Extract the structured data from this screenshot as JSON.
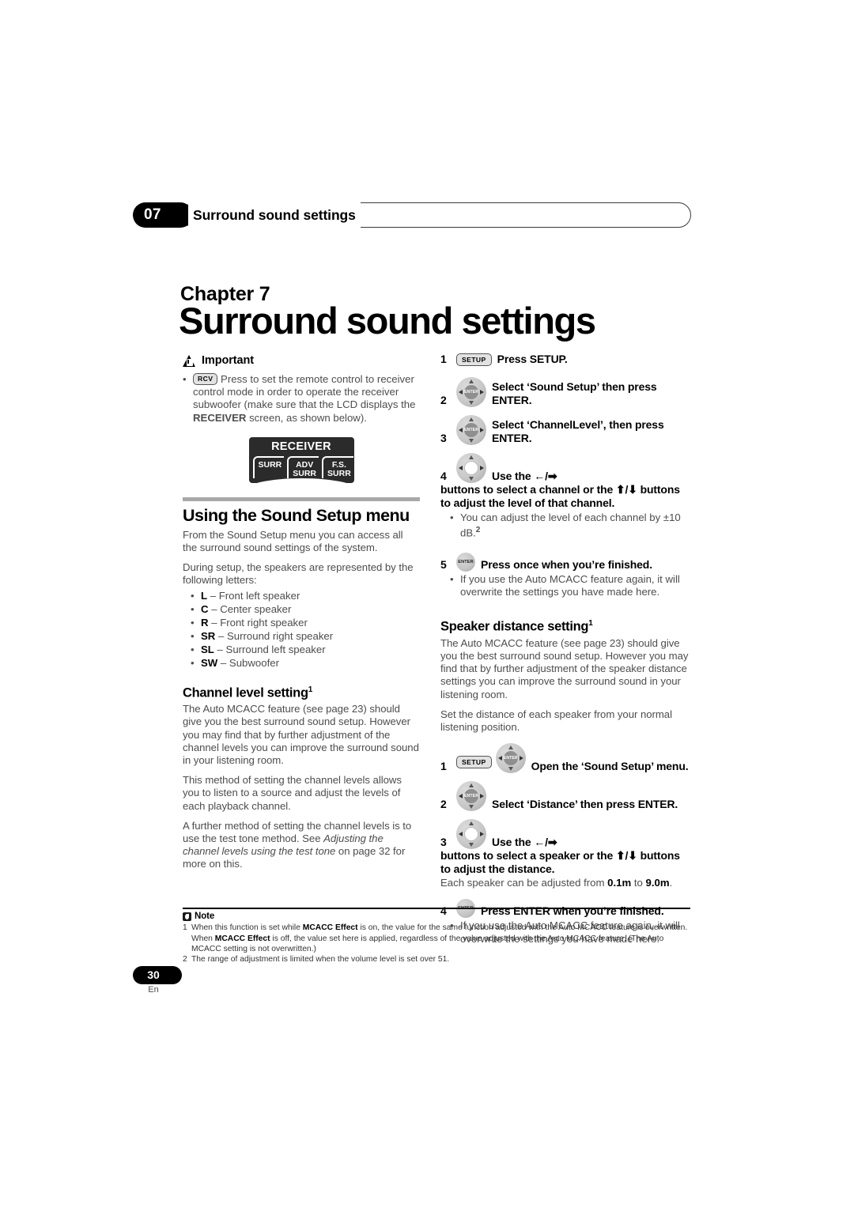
{
  "header": {
    "chapter_number": "07",
    "running_title": "Surround sound settings"
  },
  "chapter": {
    "label": "Chapter 7",
    "title": "Surround sound settings"
  },
  "left_column": {
    "important": {
      "heading": "Important",
      "icon": "warning-triangle-icon",
      "bullet_key": "RCV",
      "bullet_text_1": "Press to set the remote control to receiver control mode in order to operate the receiver subwoofer (make sure that the LCD displays the ",
      "bullet_bold": "RECEIVER",
      "bullet_text_2": " screen, as shown below)."
    },
    "lcd": {
      "title": "RECEIVER",
      "tabs": [
        "SURR",
        "ADV\nSURR",
        "F.S.\nSURR"
      ],
      "tab1": "SURR",
      "tab2_line1": "ADV",
      "tab2_line2": "SURR",
      "tab3_line1": "F.S.",
      "tab3_line2": "SURR"
    },
    "sound_setup": {
      "heading": "Using the Sound Setup menu",
      "para1": "From the Sound Setup menu you can access all the surround sound settings of the system.",
      "para2": "During setup, the speakers are represented by the following letters:",
      "speakers": [
        {
          "code": "L",
          "desc": " – Front left speaker"
        },
        {
          "code": "C",
          "desc": " – Center speaker"
        },
        {
          "code": "R",
          "desc": " – Front right speaker"
        },
        {
          "code": "SR",
          "desc": " – Surround right speaker"
        },
        {
          "code": "SL",
          "desc": " – Surround left speaker"
        },
        {
          "code": "SW",
          "desc": " – Subwoofer"
        }
      ]
    },
    "channel_level": {
      "heading": "Channel level setting",
      "heading_sup": "1",
      "para1": "The Auto MCACC feature (see page 23) should give you the best surround sound setup. However you may find that by further adjustment of the channel levels you can improve the surround sound in your listening room.",
      "para2": "This method of setting the channel levels allows you to listen to a source and adjust the levels of each playback channel.",
      "para3_a": "A further method of setting the channel levels is to use the test tone method. See ",
      "para3_italic": "Adjusting the channel levels using the test tone",
      "para3_b": " on page 32 for more on this."
    }
  },
  "right_column": {
    "channel_steps": [
      {
        "num": "1",
        "icons": [
          "setup-key"
        ],
        "text": "Press SETUP."
      },
      {
        "num": "2",
        "icons": [
          "nav-pad-enter"
        ],
        "text": "Select ‘Sound Setup’ then press ENTER."
      },
      {
        "num": "3",
        "icons": [
          "nav-pad-enter"
        ],
        "text": "Select ‘ChannelLevel’, then press ENTER."
      },
      {
        "num": "4",
        "icons": [
          "nav-pad-hollow"
        ],
        "text_a": "Use the ",
        "text_b": " buttons to select a channel or the ",
        "text_c": " buttons to adjust the level of that channel.",
        "sub_bullet": "You can adjust the level of each channel by ±10 dB.",
        "sub_sup": "2"
      },
      {
        "num": "5",
        "icons": [
          "enter-button"
        ],
        "text": "Press once when you’re finished.",
        "sub_bullet": "If you use the Auto MCACC feature again, it will overwrite the settings you have made here."
      }
    ],
    "speaker_distance": {
      "heading": "Speaker distance setting",
      "heading_sup": "1",
      "para1": "The Auto MCACC feature (see page 23) should give you the best surround sound setup. However you may find that by further adjustment of the speaker distance settings you can improve the surround sound in your listening room.",
      "para2": "Set the distance of each speaker from your normal listening position."
    },
    "distance_steps": [
      {
        "num": "1",
        "icons": [
          "setup-key",
          "nav-pad-enter"
        ],
        "text": "Open the ‘Sound Setup’ menu."
      },
      {
        "num": "2",
        "icons": [
          "nav-pad-enter"
        ],
        "text": "Select ‘Distance’ then press ENTER."
      },
      {
        "num": "3",
        "icons": [
          "nav-pad-hollow"
        ],
        "text_a": "Use the ",
        "text_b": " buttons to select a speaker or the ",
        "text_c": " buttons to adjust the distance.",
        "note_a": "Each speaker can be adjusted from ",
        "note_min": "0.1m",
        "note_mid": " to ",
        "note_max": "9.0m",
        "note_b": "."
      },
      {
        "num": "4",
        "icons": [
          "enter-button"
        ],
        "text": "Press ENTER when you’re finished.",
        "sub_bullet": "If you use the Auto MCACC feature again, it will overwrite the settings you have made here."
      }
    ]
  },
  "icons": {
    "setup_key_label": "SETUP",
    "enter_label": "ENTER",
    "rcv_label": "RCV",
    "arrow_left": "←",
    "arrow_right": "➡",
    "arrow_up": "⬆",
    "arrow_down": "⬇",
    "slash": "/"
  },
  "notes": {
    "title": "Note",
    "items": [
      {
        "num": "1",
        "a": "When this function is set while ",
        "bold1": "MCACC Effect",
        "b": " is on, the value for the same function adjusted with the Auto MCACC feature is overwritten. When ",
        "bold2": "MCACC Effect",
        "c": " is off, the value set here is applied, regardless of the value adjusted with the Auto MCACC feature. (The Auto MCACC setting is not overwritten.)"
      },
      {
        "num": "2",
        "a": "The range of adjustment is limited when the volume level is set over 51.",
        "bold1": "",
        "b": "",
        "bold2": "",
        "c": ""
      }
    ]
  },
  "footer": {
    "page_number": "30",
    "language": "En"
  }
}
